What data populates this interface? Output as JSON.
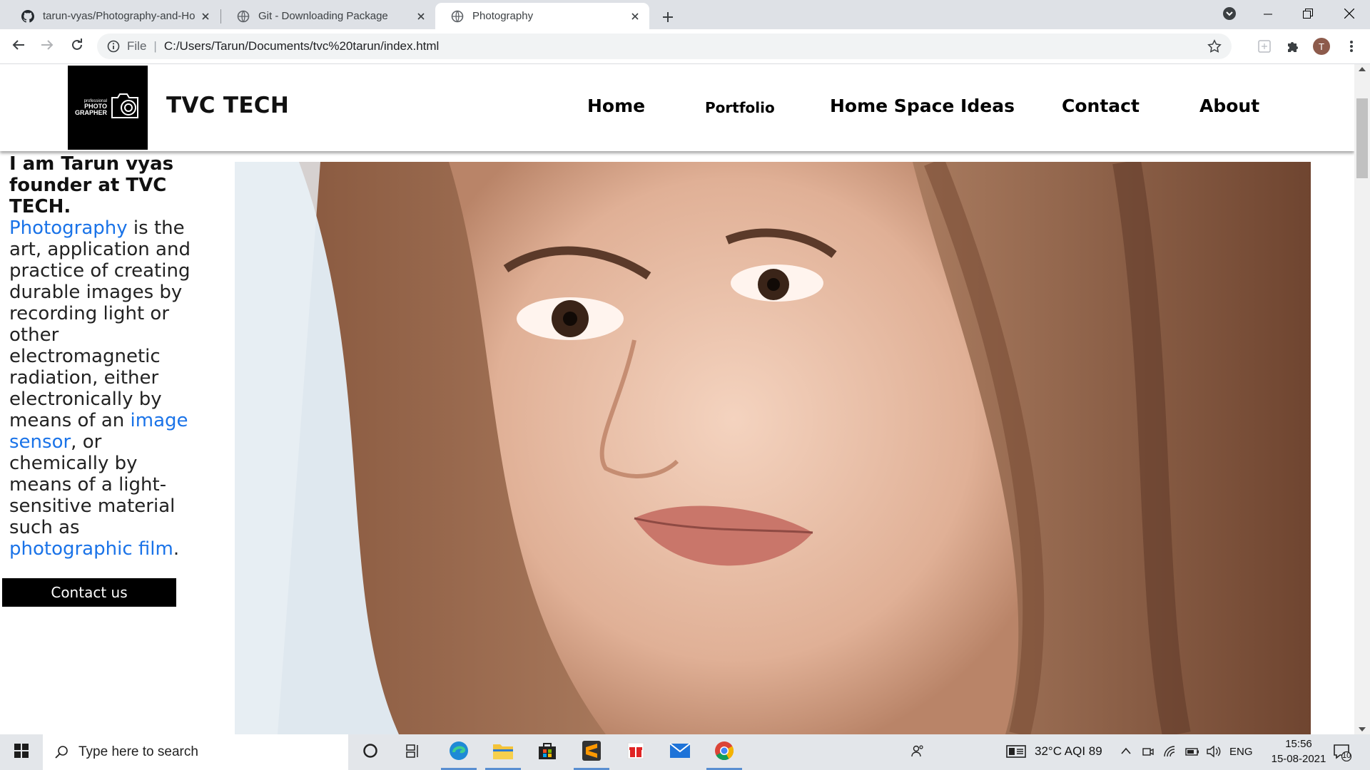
{
  "browser": {
    "tabs": [
      {
        "title": "tarun-vyas/Photography-and-Ho",
        "favicon": "github-icon",
        "active": false
      },
      {
        "title": "Git - Downloading Package",
        "favicon": "globe-icon",
        "active": false
      },
      {
        "title": "Photography",
        "favicon": "globe-icon",
        "active": true
      }
    ],
    "address": {
      "scheme_label": "File",
      "separator": "|",
      "url": "C:/Users/Tarun/Documents/tvc%20tarun/index.html"
    },
    "profile_initial": "T"
  },
  "site": {
    "logo": {
      "line1": "professional",
      "line2": "PHOTO",
      "line3": "GRAPHER"
    },
    "brand": "TVC TECH",
    "nav": [
      "Home",
      "Portfolio",
      "Home Space Ideas",
      "Contact",
      "About"
    ],
    "intro": {
      "bold": "I am Tarun vyas founder at TVC TECH.",
      "link1": "Photography",
      "text1": " is the art, application and practice of creating durable images by recording light or other electromagnetic radiation, either electronically by means of an ",
      "link2": "image sensor",
      "text2": ", or chemically by means of a light-sensitive material such as ",
      "link3": "photographic film",
      "text3": "."
    },
    "contact_button": "Contact us",
    "hero_alt": "portrait photograph"
  },
  "taskbar": {
    "search_placeholder": "Type here to search",
    "weather": "32°C  AQI 89",
    "language": "ENG",
    "time": "15:56",
    "date": "15-08-2021",
    "notification_count": "10"
  },
  "colors": {
    "link": "#1a73e8",
    "button_bg": "#000000",
    "tab_strip": "#dee1e6"
  }
}
